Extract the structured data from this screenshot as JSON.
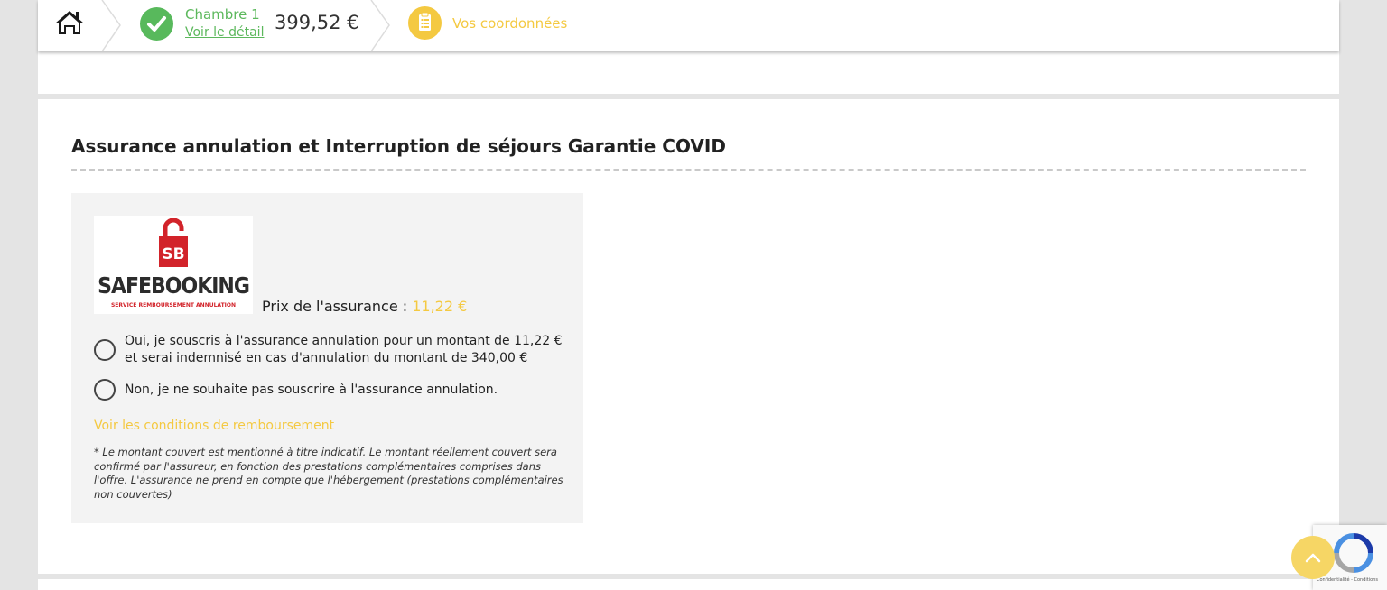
{
  "steps": {
    "home_icon": "home-icon",
    "room": {
      "title": "Chambre 1",
      "detail_link": "Voir le détail",
      "price": "399,52 €"
    },
    "contact": {
      "label": "Vos coordonnées"
    }
  },
  "insurance": {
    "section_title": "Assurance annulation et Interruption de séjours Garantie COVID",
    "logo": {
      "name": "SAFEBOOKING",
      "initials": "SB",
      "subtitle": "SERVICE REMBOURSEMENT ANNULATION"
    },
    "price_label": "Prix de l'assurance :",
    "price_value": "11,22 €",
    "option_yes": "Oui, je souscris à l'assurance annulation pour un montant de 11,22 € et serai indemnisé en cas d'annulation du montant de 340,00 €",
    "option_no": "Non, je ne souhaite pas souscrire à l'assurance annulation.",
    "conditions_link": "Voir les conditions de remboursement",
    "note": "* Le montant couvert est mentionné à titre indicatif. Le montant réellement couvert sera confirmé par l'assureur, en fonction des prestations complémentaires comprises dans l'offre. L'assurance ne prend en compte que l'hébergement (prestations complémentaires non couvertes)"
  },
  "recaptcha": {
    "text": "Confidentialité - Conditions"
  },
  "colors": {
    "green": "#5cb85c",
    "yellow": "#f4c941",
    "background": "#e4e4e4"
  }
}
